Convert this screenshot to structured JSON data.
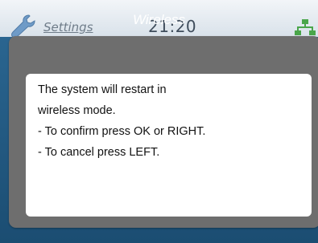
{
  "statusbar": {
    "app_label": "Settings",
    "time": "21:20",
    "settings_icon": "wrench-icon",
    "network_icon": "network-icon"
  },
  "dialog": {
    "title": "Wireless",
    "lines": [
      "The system will restart in",
      "wireless mode.",
      "- To confirm press OK or RIGHT.",
      "- To cancel press LEFT."
    ]
  },
  "colors": {
    "background_blue": "#1b4d72",
    "dialog_gray": "#6e6e6e",
    "dialog_body": "#ffffff"
  }
}
